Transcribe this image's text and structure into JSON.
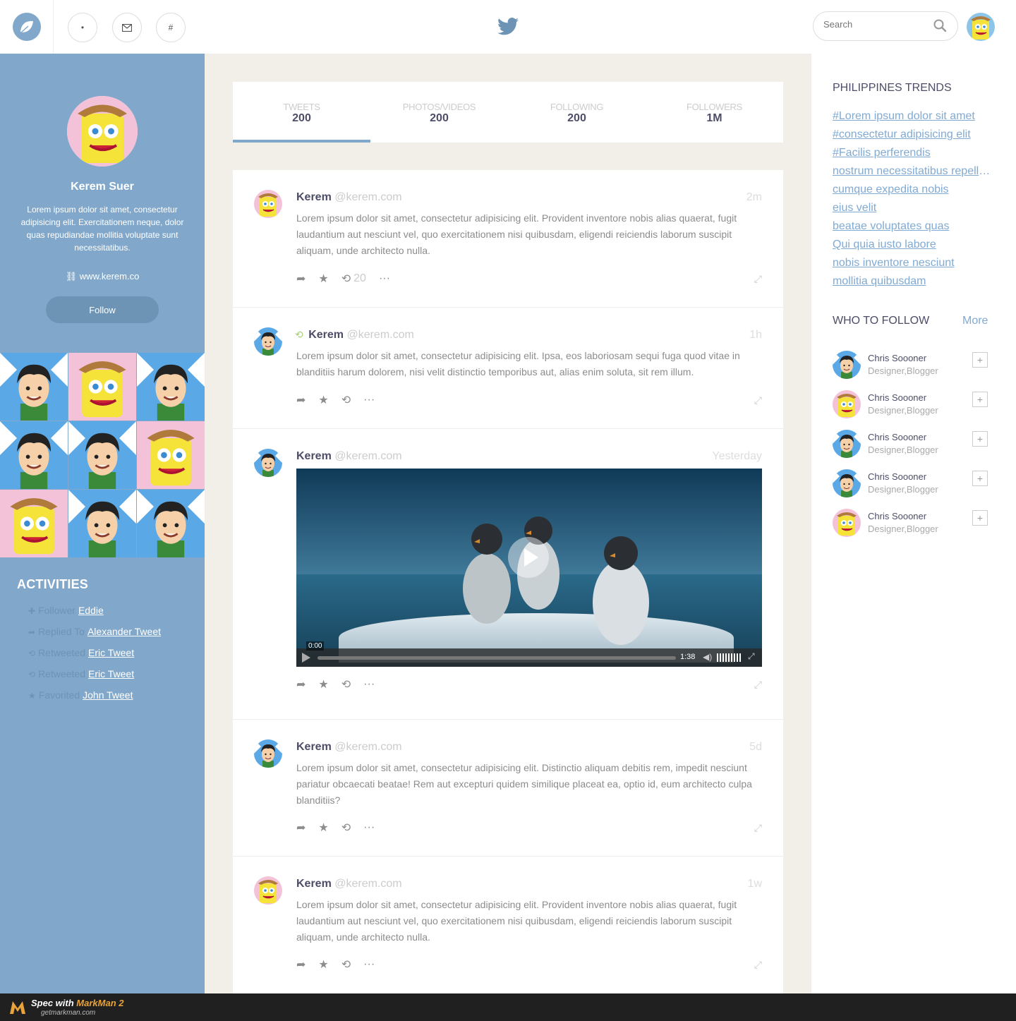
{
  "nav": {
    "mail_icon": "mail-icon",
    "hashtag_label": "#",
    "search_placeholder": "Search"
  },
  "colors": {
    "primary": "#81a8ca",
    "primary_dark": "#6d94b5",
    "link": "#81aad3",
    "background": "#f2eee8",
    "text": "#4d4d68",
    "muted": "#8c8c8c",
    "light": "#cccccc",
    "retweet": "#a8cf71"
  },
  "profile": {
    "name": "Kerem Suer",
    "bio": "Lorem ipsum dolor sit amet, consectetur adipisicing elit. Exercitationem neque, dolor quas repudiandae mollitia voluptate sunt necessitatibus.",
    "website": "www.kerem.co",
    "follow_label": "Follow"
  },
  "photo_grid": [
    "boy",
    "sponge",
    "boy",
    "boy",
    "boy",
    "sponge",
    "sponge",
    "boy",
    "boy"
  ],
  "activities": {
    "title": "ACTIVITIES",
    "items": [
      {
        "icon": "plus-icon",
        "verb": "Follower",
        "target": "Eddie"
      },
      {
        "icon": "reply-icon",
        "verb": "Replied To",
        "target": "Alexander Tweet"
      },
      {
        "icon": "retweet-icon",
        "verb": "Retweeted",
        "target": "Eric Tweet"
      },
      {
        "icon": "retweet-icon",
        "verb": "Retweeted",
        "target": "Eric Tweet"
      },
      {
        "icon": "star-icon",
        "verb": "Favorited",
        "target": "John Tweet"
      }
    ]
  },
  "stats": [
    {
      "label": "Tweets",
      "value": "200",
      "active": true
    },
    {
      "label": "Photos/Videos",
      "value": "200",
      "active": false
    },
    {
      "label": "Following",
      "value": "200",
      "active": false
    },
    {
      "label": "Followers",
      "value": "1M",
      "active": false
    }
  ],
  "tweets": [
    {
      "name": "Kerem",
      "handle": "@kerem.com",
      "time": "2m",
      "avatar": "sponge",
      "retweet": false,
      "text": "Lorem ipsum dolor sit amet, consectetur adipisicing elit. Provident inventore nobis alias quaerat, fugit laudantium aut nesciunt vel, quo exercitationem nisi quibusdam, eligendi reiciendis laborum suscipit aliquam, unde architecto nulla.",
      "retweet_count": "20"
    },
    {
      "name": "Kerem",
      "handle": "@kerem.com",
      "time": "1h",
      "avatar": "boy",
      "retweet": true,
      "text": "Lorem ipsum dolor sit amet, consectetur adipisicing elit. Ipsa, eos laboriosam sequi fuga quod vitae in blanditiis harum dolorem, nisi velit distinctio temporibus aut, alias enim soluta, sit rem illum.",
      "retweet_count": ""
    },
    {
      "name": "Kerem",
      "handle": "@kerem.com",
      "time": "Yesterday",
      "avatar": "boy",
      "retweet": false,
      "text": "",
      "retweet_count": "",
      "video": {
        "current_time": "0:00",
        "duration": "1:38"
      }
    },
    {
      "name": "Kerem",
      "handle": "@kerem.com",
      "time": "5d",
      "avatar": "boy",
      "retweet": false,
      "text": "Lorem ipsum dolor sit amet, consectetur adipisicing elit. Distinctio aliquam debitis rem, impedit nesciunt pariatur obcaecati beatae! Rem aut excepturi quidem similique placeat ea, optio id, eum architecto culpa blanditiis?",
      "retweet_count": ""
    },
    {
      "name": "Kerem",
      "handle": "@kerem.com",
      "time": "1w",
      "avatar": "sponge",
      "retweet": false,
      "text": "Lorem ipsum dolor sit amet, consectetur adipisicing elit. Provident inventore nobis alias quaerat, fugit laudantium aut nesciunt vel, quo exercitationem nisi quibusdam, eligendi reiciendis laborum suscipit aliquam, unde architecto nulla.",
      "retweet_count": ""
    }
  ],
  "trends": {
    "title": "PHILIPPINES TRENDS",
    "items": [
      "#Lorem ipsum dolor sit amet",
      "#consectetur adipisicing elit",
      "#Facilis perferendis",
      "nostrum necessitatibus repellendus",
      "cumque expedita nobis",
      "eius velit",
      "beatae voluptates quas",
      "Qui quia iusto labore",
      "nobis inventore nesciunt",
      "mollitia quibusdam"
    ]
  },
  "who_to_follow": {
    "title": "WHO TO FOLLOW",
    "more_label": "More",
    "people": [
      {
        "name": "Chris Soooner",
        "role": "Designer,Blogger",
        "avatar": "boy"
      },
      {
        "name": "Chris Soooner",
        "role": "Designer,Blogger",
        "avatar": "sponge"
      },
      {
        "name": "Chris Soooner",
        "role": "Designer,Blogger",
        "avatar": "boy"
      },
      {
        "name": "Chris Soooner",
        "role": "Designer,Blogger",
        "avatar": "boy"
      },
      {
        "name": "Chris Soooner",
        "role": "Designer,Blogger",
        "avatar": "sponge"
      }
    ]
  },
  "footer": {
    "spec_prefix": "Spec with ",
    "brand": "MarkMan 2",
    "url": "getmarkman.com"
  }
}
